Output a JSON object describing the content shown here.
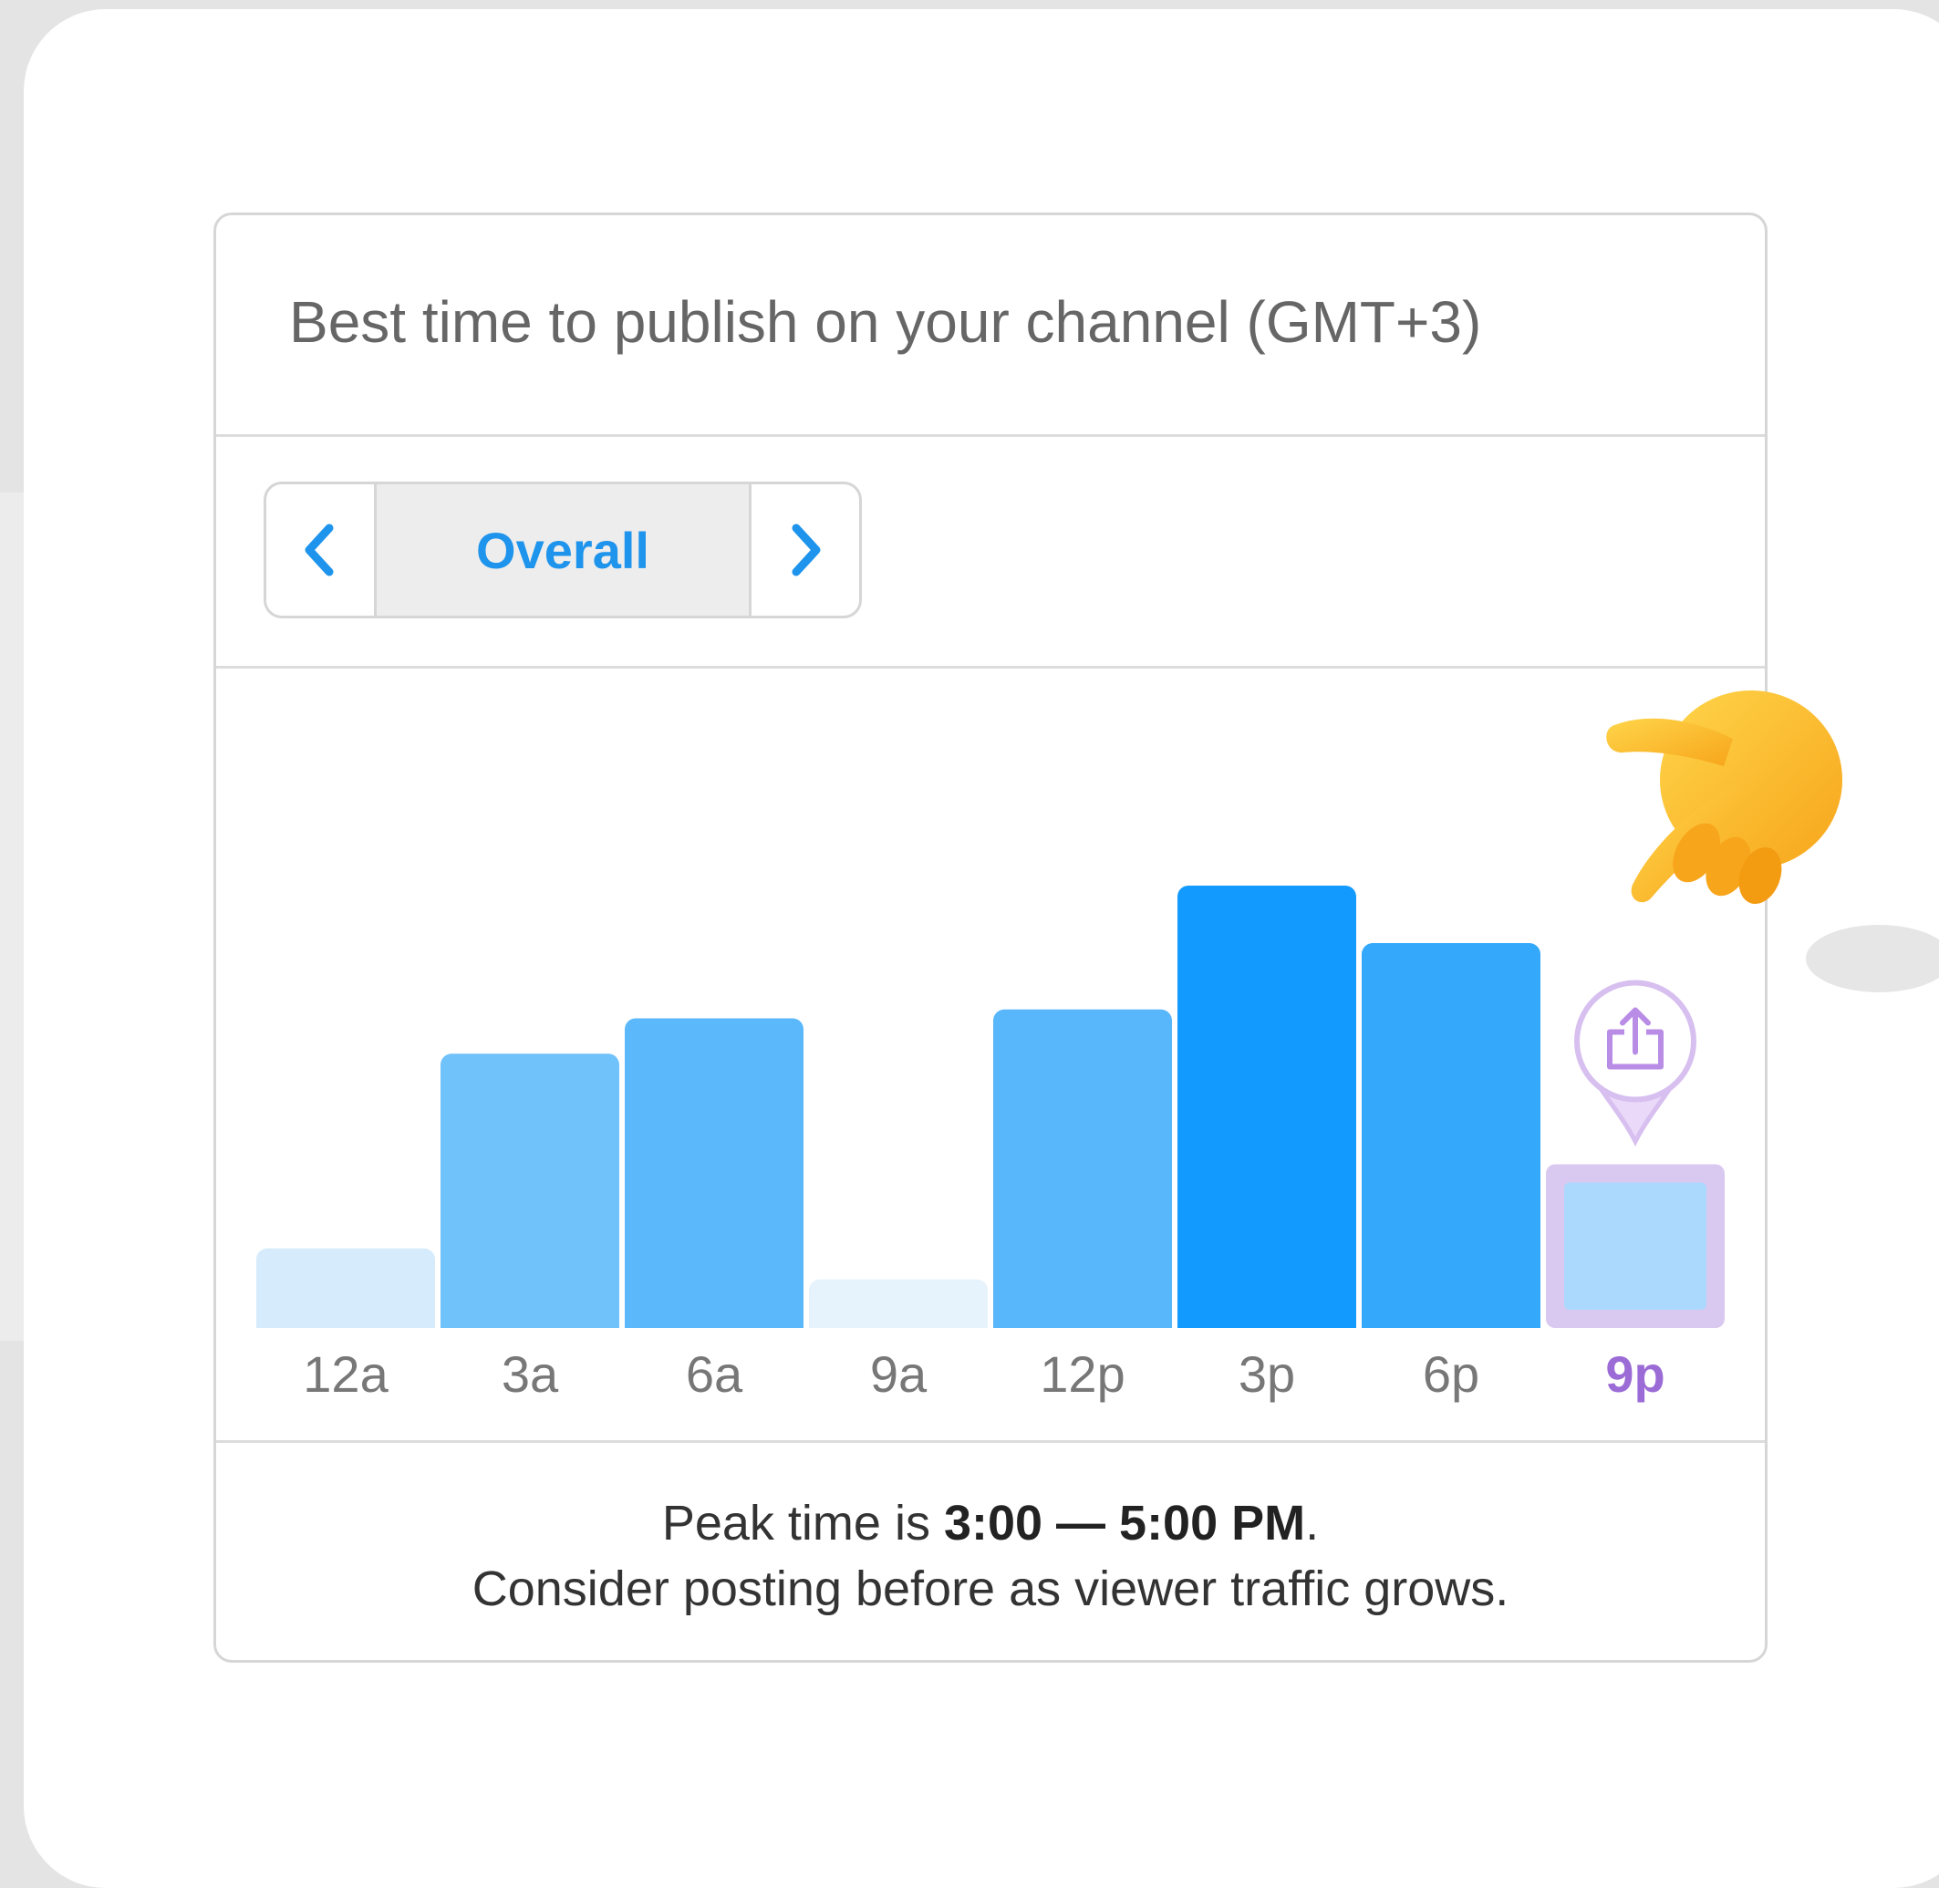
{
  "card": {
    "title": "Best time to publish on your channel (GMT+3)"
  },
  "selector": {
    "prev_icon": "chevron-left-icon",
    "label": "Overall",
    "next_icon": "chevron-right-icon"
  },
  "chart_data": {
    "type": "bar",
    "categories": [
      "12a",
      "3a",
      "6a",
      "9a",
      "12p",
      "3p",
      "6p",
      "9p"
    ],
    "values": [
      18,
      62,
      70,
      11,
      72,
      100,
      87,
      37
    ],
    "ylim": [
      0,
      100
    ],
    "highlighted_category": "9p",
    "highlight_icon": "share-icon",
    "colors": {
      "12a": "#d6ecfc",
      "3a": "#70c2fb",
      "6a": "#5ab8fb",
      "9a": "#e6f3fd",
      "12p": "#58b6fa",
      "3p": "#129aff",
      "6p": "#34a9fb",
      "9p": "#aad9fd",
      "highlight": "#9b6bd6",
      "label": "#777777"
    }
  },
  "message": {
    "prefix": "Peak time is ",
    "peak": "3:00 — 5:00 PM",
    "suffix": ".",
    "line2": "Consider posting before as viewer traffic grows."
  }
}
